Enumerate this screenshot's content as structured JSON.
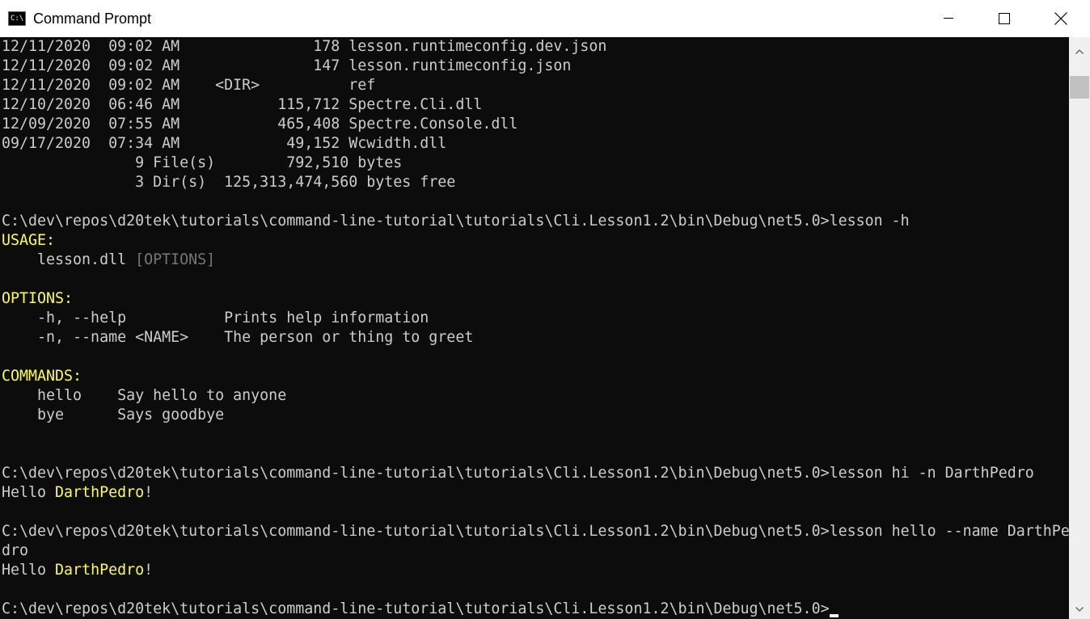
{
  "window": {
    "title": "Command Prompt",
    "app_icon_text": "C:\\"
  },
  "console": {
    "lines": [
      {
        "segments": [
          {
            "text": "12/11/2020  09:02 AM               178 lesson.runtimeconfig.dev.json",
            "style": "normal"
          }
        ]
      },
      {
        "segments": [
          {
            "text": "12/11/2020  09:02 AM               147 lesson.runtimeconfig.json",
            "style": "normal"
          }
        ]
      },
      {
        "segments": [
          {
            "text": "12/11/2020  09:02 AM    <DIR>          ref",
            "style": "normal"
          }
        ]
      },
      {
        "segments": [
          {
            "text": "12/10/2020  06:46 AM           115,712 Spectre.Cli.dll",
            "style": "normal"
          }
        ]
      },
      {
        "segments": [
          {
            "text": "12/09/2020  07:55 AM           465,408 Spectre.Console.dll",
            "style": "normal"
          }
        ]
      },
      {
        "segments": [
          {
            "text": "09/17/2020  07:34 AM            49,152 Wcwidth.dll",
            "style": "normal"
          }
        ]
      },
      {
        "segments": [
          {
            "text": "               9 File(s)        792,510 bytes",
            "style": "normal"
          }
        ]
      },
      {
        "segments": [
          {
            "text": "               3 Dir(s)  125,313,474,560 bytes free",
            "style": "normal"
          }
        ]
      },
      {
        "segments": [
          {
            "text": "",
            "style": "normal"
          }
        ]
      },
      {
        "segments": [
          {
            "text": "C:\\dev\\repos\\d20tek\\tutorials\\command-line-tutorial\\tutorials\\Cli.Lesson1.2\\bin\\Debug\\net5.0>lesson -h",
            "style": "normal"
          }
        ]
      },
      {
        "segments": [
          {
            "text": "USAGE:",
            "style": "yellow"
          }
        ]
      },
      {
        "segments": [
          {
            "text": "    lesson.dll ",
            "style": "normal"
          },
          {
            "text": "[OPTIONS]",
            "style": "gray"
          }
        ]
      },
      {
        "segments": [
          {
            "text": "",
            "style": "normal"
          }
        ]
      },
      {
        "segments": [
          {
            "text": "OPTIONS:",
            "style": "yellow"
          }
        ]
      },
      {
        "segments": [
          {
            "text": "    -h, --help           Prints help information",
            "style": "normal"
          }
        ]
      },
      {
        "segments": [
          {
            "text": "    -n, --name <NAME>    The person or thing to greet",
            "style": "normal"
          }
        ]
      },
      {
        "segments": [
          {
            "text": "",
            "style": "normal"
          }
        ]
      },
      {
        "segments": [
          {
            "text": "COMMANDS:",
            "style": "yellow"
          }
        ]
      },
      {
        "segments": [
          {
            "text": "    hello    Say hello to anyone",
            "style": "normal"
          }
        ]
      },
      {
        "segments": [
          {
            "text": "    bye      Says goodbye",
            "style": "normal"
          }
        ]
      },
      {
        "segments": [
          {
            "text": "",
            "style": "normal"
          }
        ]
      },
      {
        "segments": [
          {
            "text": "",
            "style": "normal"
          }
        ]
      },
      {
        "segments": [
          {
            "text": "C:\\dev\\repos\\d20tek\\tutorials\\command-line-tutorial\\tutorials\\Cli.Lesson1.2\\bin\\Debug\\net5.0>lesson hi -n DarthPedro",
            "style": "normal"
          }
        ]
      },
      {
        "segments": [
          {
            "text": "Hello ",
            "style": "normal"
          },
          {
            "text": "DarthPedro",
            "style": "yellow"
          },
          {
            "text": "!",
            "style": "normal"
          }
        ]
      },
      {
        "segments": [
          {
            "text": "",
            "style": "normal"
          }
        ]
      },
      {
        "segments": [
          {
            "text": "C:\\dev\\repos\\d20tek\\tutorials\\command-line-tutorial\\tutorials\\Cli.Lesson1.2\\bin\\Debug\\net5.0>lesson hello --name DarthPe",
            "style": "normal"
          }
        ]
      },
      {
        "segments": [
          {
            "text": "dro",
            "style": "normal"
          }
        ]
      },
      {
        "segments": [
          {
            "text": "Hello ",
            "style": "normal"
          },
          {
            "text": "DarthPedro",
            "style": "yellow"
          },
          {
            "text": "!",
            "style": "normal"
          }
        ]
      },
      {
        "segments": [
          {
            "text": "",
            "style": "normal"
          }
        ]
      },
      {
        "segments": [
          {
            "text": "C:\\dev\\repos\\d20tek\\tutorials\\command-line-tutorial\\tutorials\\Cli.Lesson1.2\\bin\\Debug\\net5.0>",
            "style": "normal"
          }
        ]
      }
    ]
  },
  "colors": {
    "background": "#0c0c0c",
    "text": "#cccccc",
    "yellow": "#ffff44",
    "gray": "#767676"
  },
  "icons": {
    "minimize": "minimize-icon",
    "maximize": "maximize-icon",
    "close": "close-icon",
    "scroll_up": "arrow-up-icon",
    "scroll_down": "arrow-down-icon"
  }
}
